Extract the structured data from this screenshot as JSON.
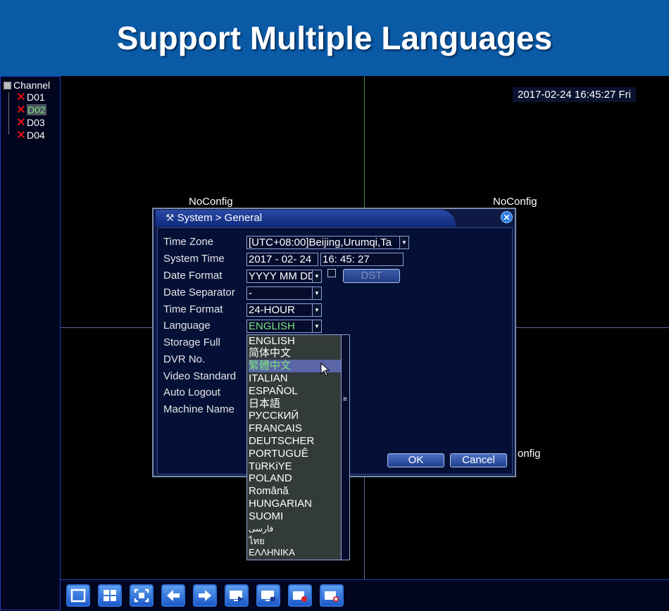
{
  "banner": {
    "title": "Support Multiple Languages"
  },
  "sidebar": {
    "root_label": "Channel",
    "items": [
      {
        "label": "D01",
        "selected": false
      },
      {
        "label": "D02",
        "selected": true
      },
      {
        "label": "D03",
        "selected": false
      },
      {
        "label": "D04",
        "selected": false
      }
    ]
  },
  "grid": {
    "datetime": "2017-02-24 16:45:27 Fri",
    "noconfig": [
      "NoConfig",
      "NoConfig",
      "onfig"
    ]
  },
  "dialog": {
    "title": "System > General",
    "labels": {
      "time_zone": "Time Zone",
      "system_time": "System Time",
      "date_format": "Date Format",
      "date_separator": "Date Separator",
      "time_format": "Time Format",
      "language": "Language",
      "storage_full": "Storage Full",
      "dvr_no": "DVR No.",
      "video_standard": "Video Standard",
      "auto_logout": "Auto Logout",
      "machine_name": "Machine Name"
    },
    "values": {
      "time_zone": "[UTC+08:00]Beijing,Urumqi,Ta",
      "system_date": "2017 - 02- 24",
      "system_clock": "16: 45: 27",
      "date_format": "YYYY MM DD",
      "date_separator": "-",
      "time_format": "24-HOUR",
      "language": "ENGLISH"
    },
    "dst_button": "DST",
    "ok_button": "OK",
    "cancel_button": "Cancel"
  },
  "language_list": {
    "options": [
      "ENGLISH",
      "简体中文",
      "繁體中文",
      "ITALIAN",
      "ESPAÑOL",
      "日本語",
      "РУССКИЙ",
      "FRANCAIS",
      "DEUTSCHER",
      "PORTUGUÊ",
      "TüRKiYE",
      "POLAND",
      "Română",
      "HUNGARIAN",
      "SUOMI",
      "فارسی",
      "ไทย",
      "ΕΛΛΗΝΙΚΑ"
    ],
    "hovered_index": 2
  },
  "toolbar": {
    "icons": [
      "single-view-icon",
      "quad-view-icon",
      "fullscreen-icon",
      "previous-icon",
      "next-icon",
      "playback-icon",
      "monitor-icon",
      "record-icon",
      "stop-record-icon"
    ]
  },
  "colors": {
    "banner": "#0a5aa6",
    "selected_text": "#7ee07e",
    "error_x": "#e01010"
  }
}
